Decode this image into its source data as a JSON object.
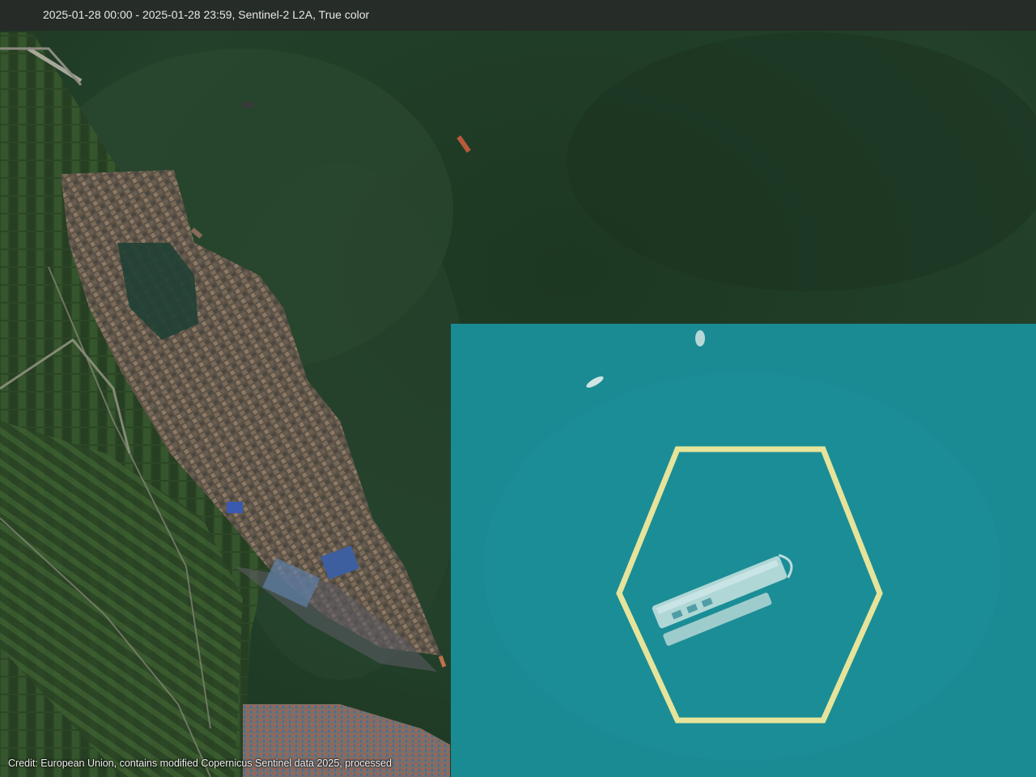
{
  "header": {
    "date_range": "2025-01-28 00:00 - 2025-01-28 23:59, Sentinel-2 L2A, True color"
  },
  "credit": {
    "text": "Credit: European Union, contains modified Copernicus Sentinel data 2025, processed"
  },
  "colors": {
    "sea": "#1f3a24",
    "inset_sea": "#1a8a93",
    "highlight_hexagon": "#e6e49a"
  }
}
